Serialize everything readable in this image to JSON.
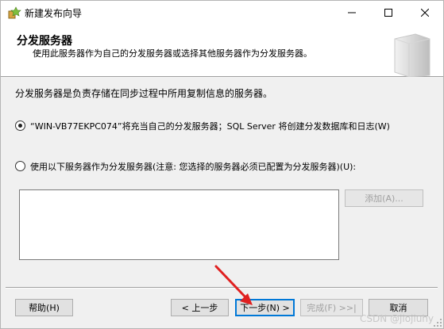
{
  "window": {
    "title": "新建发布向导"
  },
  "header": {
    "title": "分发服务器",
    "subtitle": "使用此服务器作为自己的分发服务器或选择其他服务器作为分发服务器。"
  },
  "description": "分发服务器是负责存储在同步过程中所用复制信息的服务器。",
  "options": [
    {
      "label": "“WIN-VB77EKPC074”将充当自己的分发服务器；SQL Server 将创建分发数据库和日志(W)",
      "checked": true
    },
    {
      "label": "使用以下服务器作为分发服务器(注意: 您选择的服务器必须已配置为分发服务器)(U):",
      "checked": false
    }
  ],
  "add_button": "添加(A)...",
  "buttons": {
    "help": "帮助(H)",
    "back": "< 上一步",
    "next": "下一步(N) >",
    "finish": "完成(F) >>|",
    "cancel": "取消"
  },
  "watermark": "CSDN @jiojiuhy",
  "colors": {
    "accent": "#0078d7",
    "arrow": "#e02020"
  }
}
